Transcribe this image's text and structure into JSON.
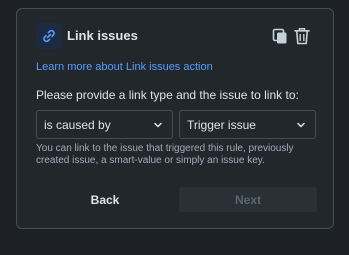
{
  "colors": {
    "background": "#1d2125",
    "card": "#22272b",
    "border": "#454d55",
    "text": "#dee4ea",
    "subtle_text": "#9fadbc",
    "link": "#579dff",
    "disabled_text": "#596773",
    "disabled_bg": "#2a3036"
  },
  "header": {
    "icon": "link-icon",
    "title": "Link issues",
    "actions": [
      {
        "icon": "copy-icon"
      },
      {
        "icon": "trash-icon"
      }
    ]
  },
  "learn_link": "Learn more about Link issues action",
  "prompt": "Please provide a link type and the issue to link to:",
  "fields": {
    "link_type": {
      "value": "is caused by",
      "icon": "chevron-down-icon"
    },
    "issue": {
      "value": "Trigger issue",
      "icon": "chevron-down-icon"
    }
  },
  "help_text": "You can link to the issue that triggered this rule, previously created issue, a smart-value or simply an issue key.",
  "footer": {
    "back_label": "Back",
    "next_label": "Next",
    "next_disabled": true
  }
}
